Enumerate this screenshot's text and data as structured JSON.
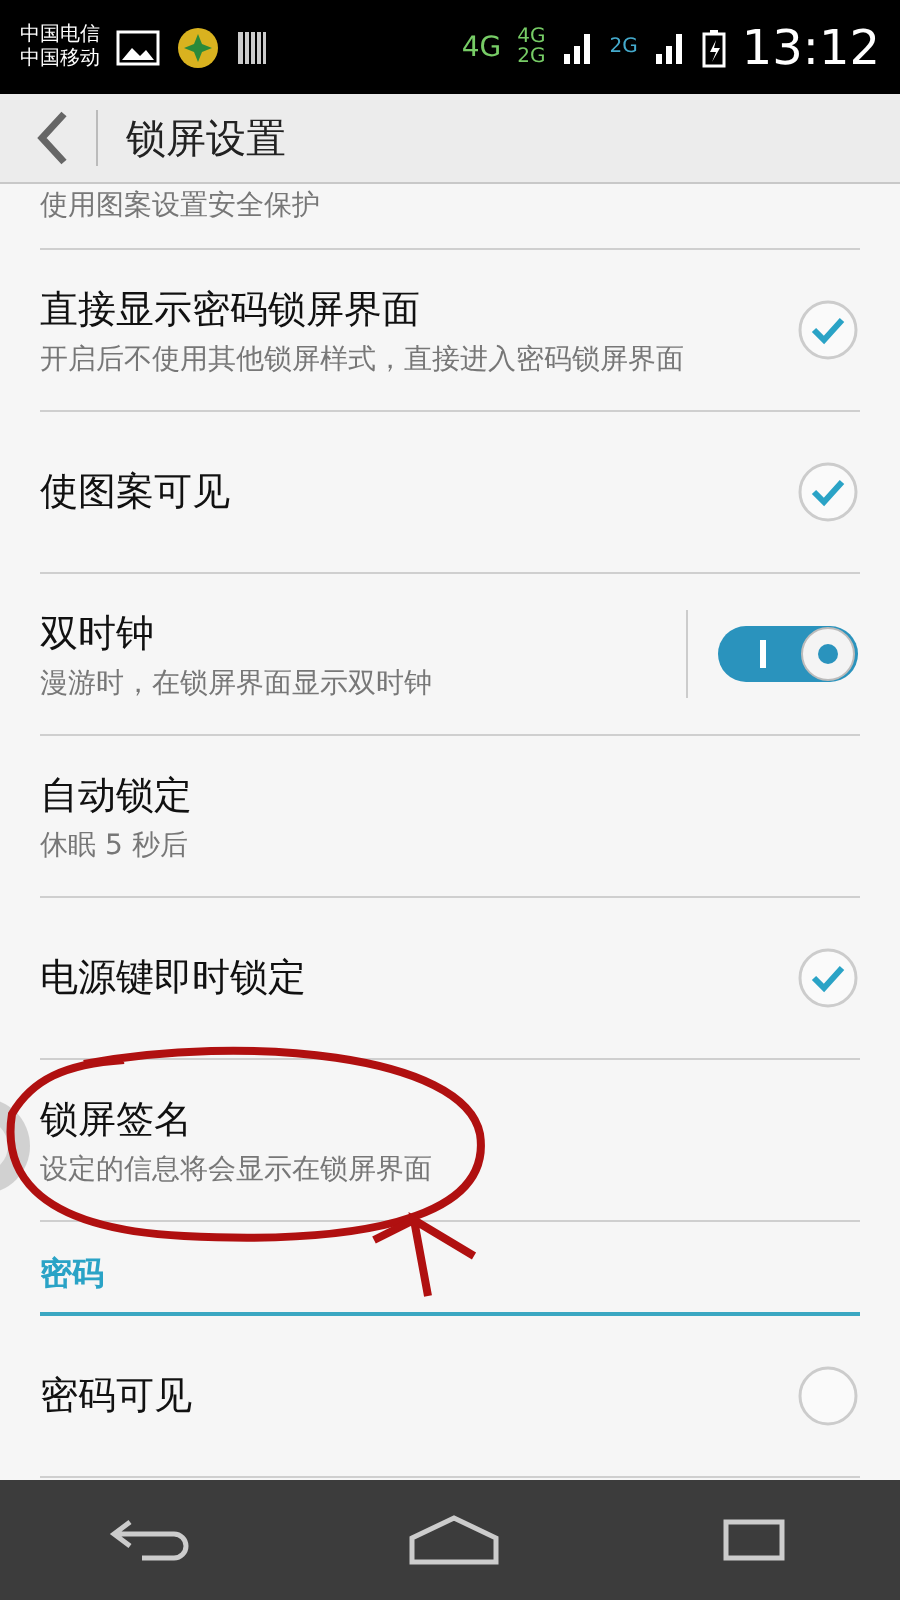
{
  "status_bar": {
    "carriers": [
      "中国电信",
      "中国移动"
    ],
    "network_labels": [
      "4G",
      "4G",
      "2G",
      "2G"
    ],
    "time": "13:12"
  },
  "header": {
    "title": "锁屏设置"
  },
  "settings": [
    {
      "kind": "none",
      "subtitle": "使用图案设置安全保护"
    },
    {
      "kind": "check",
      "title": "直接显示密码锁屏界面",
      "subtitle": "开启后不使用其他锁屏样式，直接进入密码锁屏界面",
      "checked": true
    },
    {
      "kind": "check",
      "title": "使图案可见",
      "checked": true
    },
    {
      "kind": "toggle",
      "title": "双时钟",
      "subtitle": "漫游时，在锁屏界面显示双时钟",
      "checked": true
    },
    {
      "kind": "none",
      "title": "自动锁定",
      "subtitle": "休眠 5 秒后"
    },
    {
      "kind": "check",
      "title": "电源键即时锁定",
      "checked": true
    },
    {
      "kind": "none",
      "title": "锁屏签名",
      "subtitle": "设定的信息将会显示在锁屏界面"
    },
    {
      "kind": "section",
      "title": "密码"
    },
    {
      "kind": "radio",
      "title": "密码可见",
      "checked": false
    }
  ]
}
